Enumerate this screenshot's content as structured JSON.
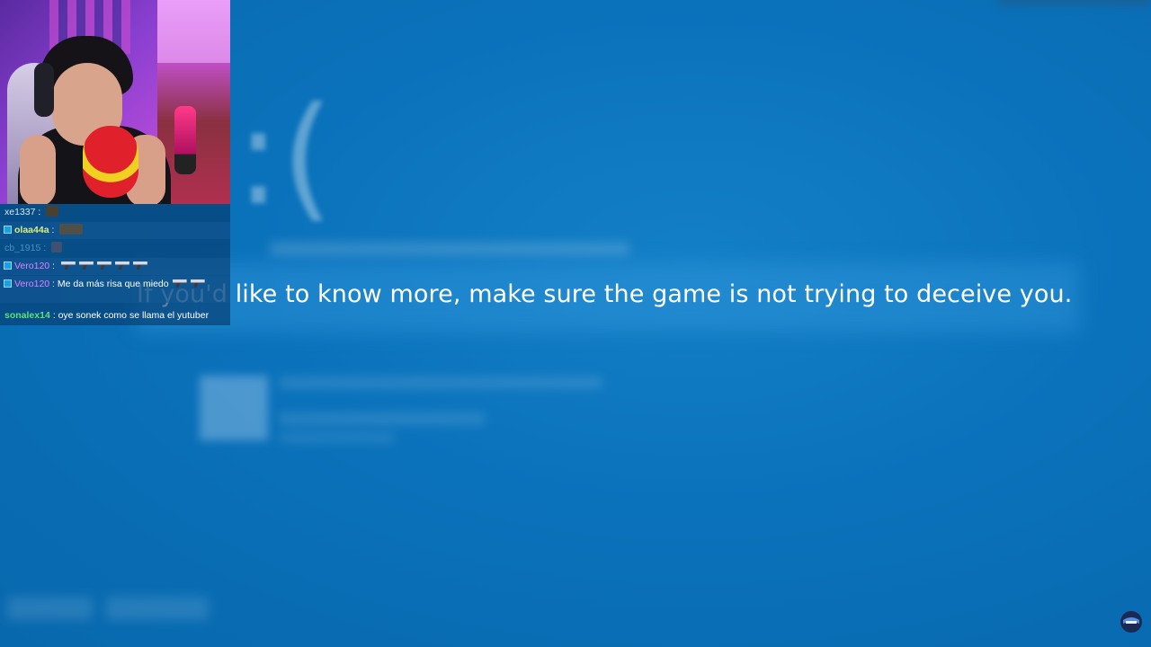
{
  "screen": {
    "background_color": "#0a6fb8",
    "sad_face": ":(",
    "message": "If you'd like to know more, make sure the game is not trying to deceive you."
  },
  "webcam": {
    "icon": "streamer-webcam"
  },
  "chat": {
    "messages": [
      {
        "user": "xe1337",
        "user_color": "#d8e6f2",
        "badge": false,
        "text": "",
        "emotes": [
          "emote-face"
        ]
      },
      {
        "user": "olaa44a",
        "user_color": "#d7f07a",
        "badge": true,
        "text": "",
        "emotes": [
          "emote-gun-wide"
        ]
      },
      {
        "user": "cb_1915",
        "user_color": "#4e8fc0",
        "badge": false,
        "text": "",
        "emotes": [
          "emote-small"
        ]
      },
      {
        "user": "Vero120",
        "user_color": "#e080ff",
        "badge": true,
        "text": "",
        "emotes": [
          "gun",
          "gun",
          "gun",
          "gun",
          "gun"
        ]
      },
      {
        "user": "Vero120",
        "user_color": "#e080ff",
        "badge": true,
        "text": "Me da más risa que miedo",
        "emotes": [
          "gun",
          "gun",
          "gun"
        ]
      },
      {
        "user": "sonalex14",
        "user_color": "#5ee07a",
        "badge": false,
        "text": "oye sonek como se llama el yutuber",
        "emotes": []
      }
    ]
  },
  "corner_logo": {
    "icon": "ninja-logo-icon"
  }
}
